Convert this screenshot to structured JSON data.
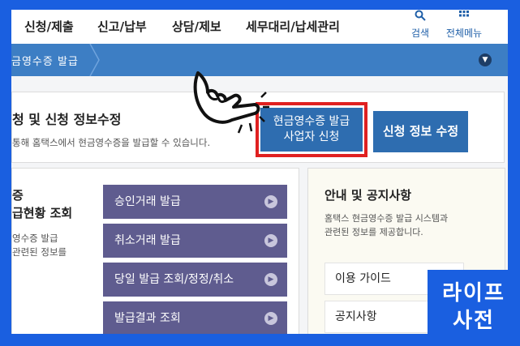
{
  "nav": {
    "items": [
      "신청/제출",
      "신고/납부",
      "상담/제보",
      "세무대리/납세관리"
    ],
    "search_label": "검색",
    "menu_label": "전체메뉴"
  },
  "breadcrumb": {
    "current": "금영수증 발급"
  },
  "apply": {
    "title": "청 및 신청 정보수정",
    "desc": "통해 홈택스에서 현금영수증을 발급할 수 있습니다.",
    "issue_button": [
      "현금영수증 발급",
      "사업자 신청"
    ],
    "edit_button": "신청 정보 수정"
  },
  "left": {
    "title_lines": [
      "증",
      "급현황 조회"
    ],
    "desc_lines": [
      "영수증 발급",
      "관련된 정보를"
    ],
    "menu": [
      "승인거래 발급",
      "취소거래 발급",
      "당일 발급 조회/정정/취소",
      "발급결과 조회"
    ]
  },
  "right": {
    "title": "안내 및 공지사항",
    "desc_lines": [
      "홈택스 현금영수증 발급 시스템과",
      "관련된 정보를 제공합니다."
    ],
    "links": [
      "이용 가이드",
      "공지사항"
    ]
  },
  "watermark": [
    "라이프",
    "사전"
  ],
  "colors": {
    "border_blue": "#1a5fe0",
    "breadcrumb": "#3d7ec4",
    "button_blue": "#2e6db0",
    "menu_purple": "#5f5c8f",
    "highlight_red": "#e02020"
  }
}
